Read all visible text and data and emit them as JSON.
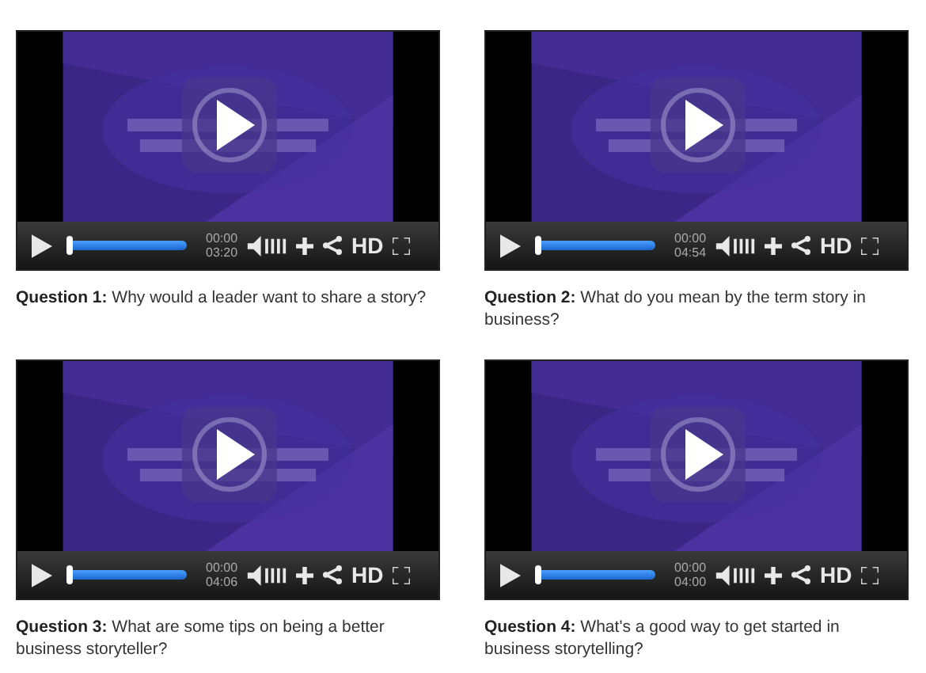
{
  "videos": [
    {
      "progress": {
        "level": 0
      },
      "current_time": "00:00",
      "duration": "03:20",
      "hd": "HD",
      "caption": "**Question 1:** Why would a leader want to share a story?"
    },
    {
      "progress": {
        "level": 0
      },
      "current_time": "00:00",
      "duration": "04:54",
      "hd": "HD",
      "caption": "**Question 2:** What do you mean by the term story in business?"
    },
    {
      "progress": {
        "level": 0
      },
      "current_time": "00:00",
      "duration": "04:06",
      "hd": "HD",
      "caption": "**Question 3:** What are some tips on being a better business storyteller?"
    },
    {
      "progress": {
        "level": 0
      },
      "current_time": "00:00",
      "duration": "04:00",
      "hd": "HD",
      "caption": "**Question 4:** What's a good way to get started in business storytelling?"
    }
  ]
}
